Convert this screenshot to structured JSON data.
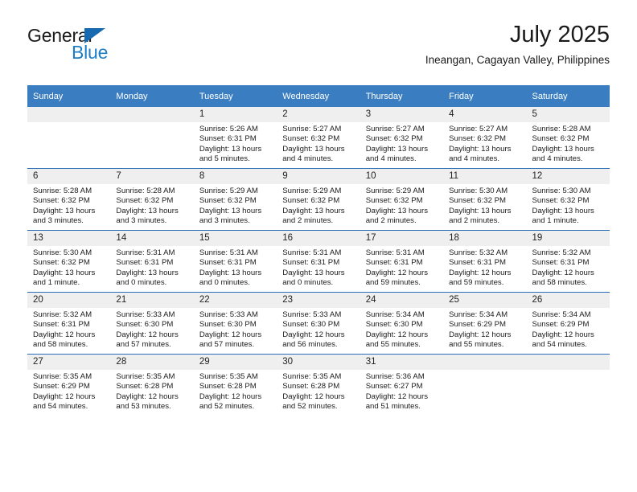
{
  "brand": {
    "name_top": "General",
    "name_bottom": "Blue",
    "triangle_color": "#1769b0",
    "blue_color": "#1d7ec4"
  },
  "header": {
    "title": "July 2025",
    "location": "Ineangan, Cagayan Valley, Philippines"
  },
  "theme": {
    "header_row_bg": "#3a7dc0",
    "header_row_text": "#ffffff",
    "week_divider": "#2a6db5",
    "daynum_bg": "#efefef",
    "cell_bg": "#ffffff"
  },
  "weekday_headers": [
    "Sunday",
    "Monday",
    "Tuesday",
    "Wednesday",
    "Thursday",
    "Friday",
    "Saturday"
  ],
  "labels": {
    "sunrise_prefix": "Sunrise:",
    "sunset_prefix": "Sunset:",
    "daylight_prefix": "Daylight:"
  },
  "weeks": [
    [
      {
        "day": "",
        "empty": true,
        "sunrise": "",
        "sunset": "",
        "daylight": ""
      },
      {
        "day": "",
        "empty": true,
        "sunrise": "",
        "sunset": "",
        "daylight": ""
      },
      {
        "day": "1",
        "sunrise": "Sunrise: 5:26 AM",
        "sunset": "Sunset: 6:31 PM",
        "daylight": "Daylight: 13 hours and 5 minutes."
      },
      {
        "day": "2",
        "sunrise": "Sunrise: 5:27 AM",
        "sunset": "Sunset: 6:32 PM",
        "daylight": "Daylight: 13 hours and 4 minutes."
      },
      {
        "day": "3",
        "sunrise": "Sunrise: 5:27 AM",
        "sunset": "Sunset: 6:32 PM",
        "daylight": "Daylight: 13 hours and 4 minutes."
      },
      {
        "day": "4",
        "sunrise": "Sunrise: 5:27 AM",
        "sunset": "Sunset: 6:32 PM",
        "daylight": "Daylight: 13 hours and 4 minutes."
      },
      {
        "day": "5",
        "sunrise": "Sunrise: 5:28 AM",
        "sunset": "Sunset: 6:32 PM",
        "daylight": "Daylight: 13 hours and 4 minutes."
      }
    ],
    [
      {
        "day": "6",
        "sunrise": "Sunrise: 5:28 AM",
        "sunset": "Sunset: 6:32 PM",
        "daylight": "Daylight: 13 hours and 3 minutes."
      },
      {
        "day": "7",
        "sunrise": "Sunrise: 5:28 AM",
        "sunset": "Sunset: 6:32 PM",
        "daylight": "Daylight: 13 hours and 3 minutes."
      },
      {
        "day": "8",
        "sunrise": "Sunrise: 5:29 AM",
        "sunset": "Sunset: 6:32 PM",
        "daylight": "Daylight: 13 hours and 3 minutes."
      },
      {
        "day": "9",
        "sunrise": "Sunrise: 5:29 AM",
        "sunset": "Sunset: 6:32 PM",
        "daylight": "Daylight: 13 hours and 2 minutes."
      },
      {
        "day": "10",
        "sunrise": "Sunrise: 5:29 AM",
        "sunset": "Sunset: 6:32 PM",
        "daylight": "Daylight: 13 hours and 2 minutes."
      },
      {
        "day": "11",
        "sunrise": "Sunrise: 5:30 AM",
        "sunset": "Sunset: 6:32 PM",
        "daylight": "Daylight: 13 hours and 2 minutes."
      },
      {
        "day": "12",
        "sunrise": "Sunrise: 5:30 AM",
        "sunset": "Sunset: 6:32 PM",
        "daylight": "Daylight: 13 hours and 1 minute."
      }
    ],
    [
      {
        "day": "13",
        "sunrise": "Sunrise: 5:30 AM",
        "sunset": "Sunset: 6:32 PM",
        "daylight": "Daylight: 13 hours and 1 minute."
      },
      {
        "day": "14",
        "sunrise": "Sunrise: 5:31 AM",
        "sunset": "Sunset: 6:31 PM",
        "daylight": "Daylight: 13 hours and 0 minutes."
      },
      {
        "day": "15",
        "sunrise": "Sunrise: 5:31 AM",
        "sunset": "Sunset: 6:31 PM",
        "daylight": "Daylight: 13 hours and 0 minutes."
      },
      {
        "day": "16",
        "sunrise": "Sunrise: 5:31 AM",
        "sunset": "Sunset: 6:31 PM",
        "daylight": "Daylight: 13 hours and 0 minutes."
      },
      {
        "day": "17",
        "sunrise": "Sunrise: 5:31 AM",
        "sunset": "Sunset: 6:31 PM",
        "daylight": "Daylight: 12 hours and 59 minutes."
      },
      {
        "day": "18",
        "sunrise": "Sunrise: 5:32 AM",
        "sunset": "Sunset: 6:31 PM",
        "daylight": "Daylight: 12 hours and 59 minutes."
      },
      {
        "day": "19",
        "sunrise": "Sunrise: 5:32 AM",
        "sunset": "Sunset: 6:31 PM",
        "daylight": "Daylight: 12 hours and 58 minutes."
      }
    ],
    [
      {
        "day": "20",
        "sunrise": "Sunrise: 5:32 AM",
        "sunset": "Sunset: 6:31 PM",
        "daylight": "Daylight: 12 hours and 58 minutes."
      },
      {
        "day": "21",
        "sunrise": "Sunrise: 5:33 AM",
        "sunset": "Sunset: 6:30 PM",
        "daylight": "Daylight: 12 hours and 57 minutes."
      },
      {
        "day": "22",
        "sunrise": "Sunrise: 5:33 AM",
        "sunset": "Sunset: 6:30 PM",
        "daylight": "Daylight: 12 hours and 57 minutes."
      },
      {
        "day": "23",
        "sunrise": "Sunrise: 5:33 AM",
        "sunset": "Sunset: 6:30 PM",
        "daylight": "Daylight: 12 hours and 56 minutes."
      },
      {
        "day": "24",
        "sunrise": "Sunrise: 5:34 AM",
        "sunset": "Sunset: 6:30 PM",
        "daylight": "Daylight: 12 hours and 55 minutes."
      },
      {
        "day": "25",
        "sunrise": "Sunrise: 5:34 AM",
        "sunset": "Sunset: 6:29 PM",
        "daylight": "Daylight: 12 hours and 55 minutes."
      },
      {
        "day": "26",
        "sunrise": "Sunrise: 5:34 AM",
        "sunset": "Sunset: 6:29 PM",
        "daylight": "Daylight: 12 hours and 54 minutes."
      }
    ],
    [
      {
        "day": "27",
        "sunrise": "Sunrise: 5:35 AM",
        "sunset": "Sunset: 6:29 PM",
        "daylight": "Daylight: 12 hours and 54 minutes."
      },
      {
        "day": "28",
        "sunrise": "Sunrise: 5:35 AM",
        "sunset": "Sunset: 6:28 PM",
        "daylight": "Daylight: 12 hours and 53 minutes."
      },
      {
        "day": "29",
        "sunrise": "Sunrise: 5:35 AM",
        "sunset": "Sunset: 6:28 PM",
        "daylight": "Daylight: 12 hours and 52 minutes."
      },
      {
        "day": "30",
        "sunrise": "Sunrise: 5:35 AM",
        "sunset": "Sunset: 6:28 PM",
        "daylight": "Daylight: 12 hours and 52 minutes."
      },
      {
        "day": "31",
        "sunrise": "Sunrise: 5:36 AM",
        "sunset": "Sunset: 6:27 PM",
        "daylight": "Daylight: 12 hours and 51 minutes."
      },
      {
        "day": "",
        "empty": true,
        "sunrise": "",
        "sunset": "",
        "daylight": ""
      },
      {
        "day": "",
        "empty": true,
        "sunrise": "",
        "sunset": "",
        "daylight": ""
      }
    ]
  ]
}
